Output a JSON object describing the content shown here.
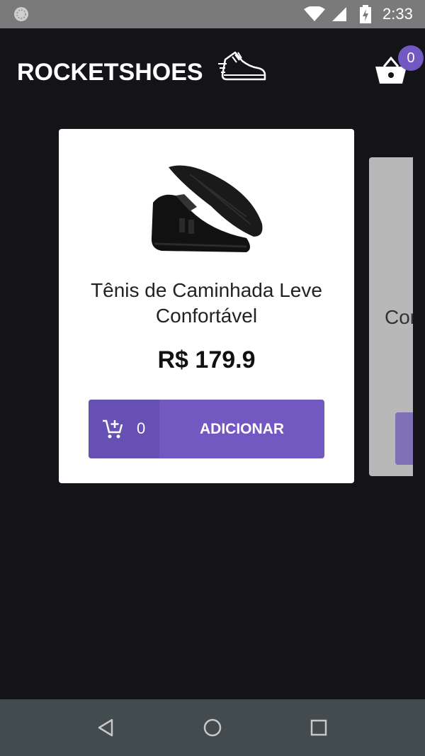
{
  "status_bar": {
    "time": "2:33",
    "icons": [
      "notification-icon",
      "wifi-icon",
      "signal-icon",
      "battery-charging-icon"
    ]
  },
  "header": {
    "logo_text": "ROCKETSHOES",
    "logo_icon": "running-shoe-icon",
    "cart_icon": "basket-icon",
    "cart_count": "0"
  },
  "products": [
    {
      "title": "Tênis de Caminhada Leve Confortável",
      "price": "R$ 179.9",
      "amount_in_cart": "0",
      "button_label": "ADICIONAR",
      "cart_icon": "add-shopping-cart-icon"
    },
    {
      "title_visible": "Cor"
    }
  ],
  "nav_bar": {
    "icons": [
      "back-icon",
      "home-icon",
      "recent-apps-icon"
    ]
  },
  "colors": {
    "background": "#131318",
    "accent": "#7159c1",
    "status_bar": "#7a7a7a",
    "nav_bar": "#424b4d"
  }
}
